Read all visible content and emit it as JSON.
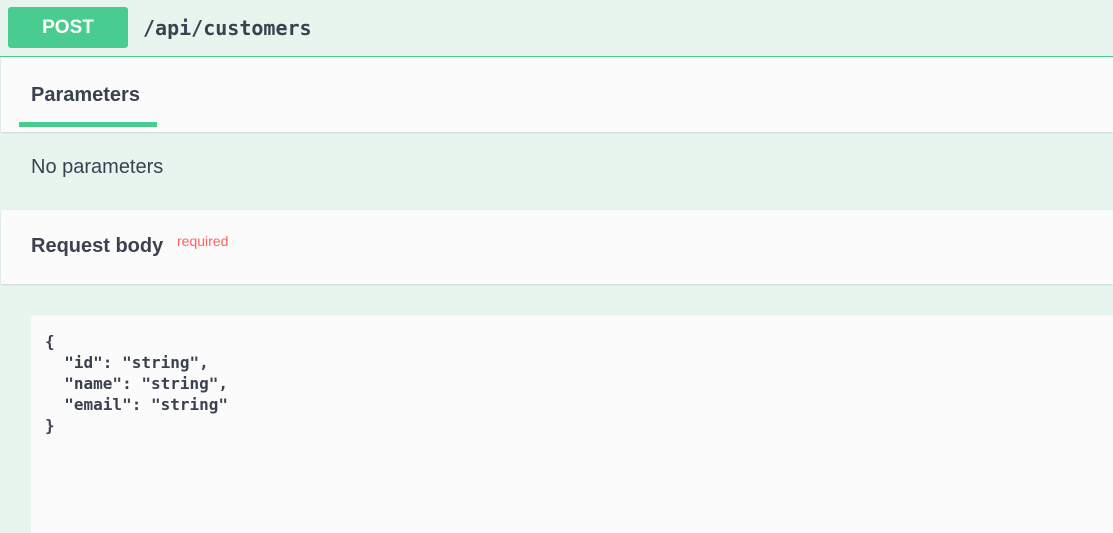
{
  "operation": {
    "method": "POST",
    "path": "/api/customers"
  },
  "tabs": {
    "parameters_label": "Parameters"
  },
  "parameters": {
    "empty_text": "No parameters"
  },
  "request_body": {
    "title": "Request body",
    "required_label": "required",
    "example": "{\n  \"id\": \"string\",\n  \"name\": \"string\",\n  \"email\": \"string\"\n}"
  },
  "colors": {
    "accent": "#49cc90",
    "background": "#e8f5ef",
    "panel": "#fafbfa",
    "text": "#3b4151",
    "required": "#ff6060"
  }
}
